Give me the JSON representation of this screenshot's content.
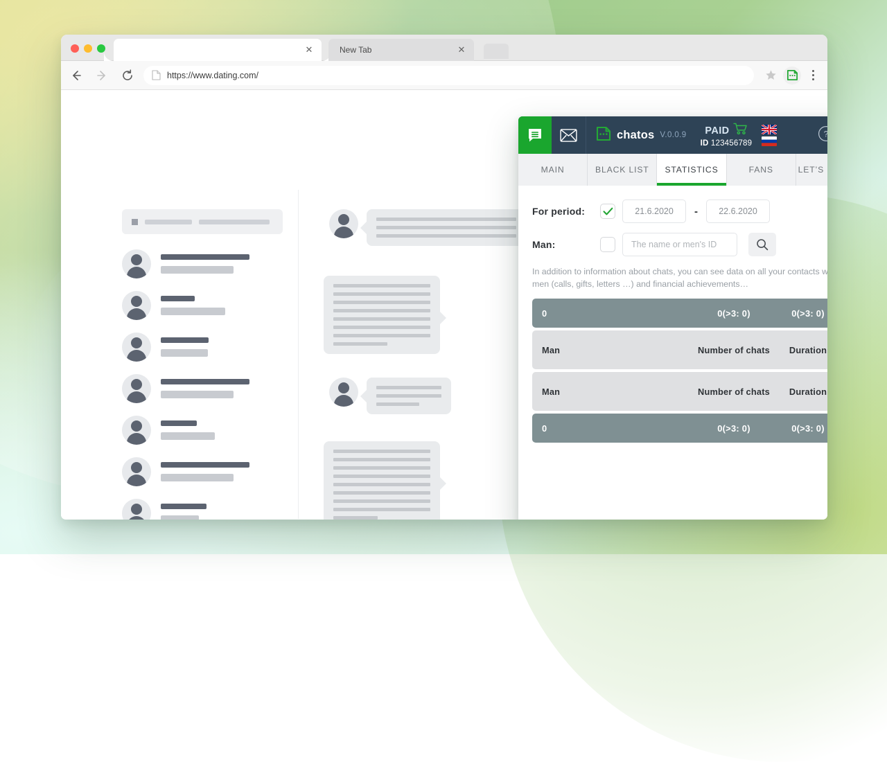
{
  "browser": {
    "tabs": [
      {
        "title": "",
        "active": true,
        "close_label": "✕"
      },
      {
        "title": "New Tab",
        "active": false,
        "close_label": "✕"
      }
    ],
    "url": "https://www.dating.com/",
    "back_icon": "back-arrow-icon",
    "forward_icon": "forward-arrow-icon",
    "reload_icon": "reload-icon",
    "page_icon": "page-document-icon",
    "bookmark_icon": "star-icon",
    "extension_icon": "chatos-extension-icon",
    "menu_icon": "three-dot-menu-icon",
    "traffic_lights": [
      "close",
      "minimize",
      "maximize"
    ]
  },
  "extension": {
    "header": {
      "chat_icon": "chat-bubble-icon",
      "mail_icon": "envelope-icon",
      "logo_icon": "chatos-logo-icon",
      "brand": "chatos",
      "version": "V.0.0.9",
      "status": "PAID",
      "cart_icon": "shopping-cart-icon",
      "id_prefix": "ID",
      "id_value": "123456789",
      "flags": [
        "flag-uk",
        "flag-russia"
      ],
      "help_icon": "help-circle-icon",
      "close_icon": "close-circle-icon",
      "bg_color": "#2e4356",
      "accent_color": "#1aa62e"
    },
    "tabs": [
      {
        "label": "MAIN",
        "active": false
      },
      {
        "label": "BLACK LIST",
        "active": false
      },
      {
        "label": "STATISTICS",
        "active": true
      },
      {
        "label": "FANS",
        "active": false
      },
      {
        "label": "LET’S MINGLE",
        "active": false
      }
    ],
    "form": {
      "period_label": "For period:",
      "period_checked": true,
      "date_from": "21.6.2020",
      "date_to": "22.6.2020",
      "date_separator": "-",
      "man_label": "Man:",
      "man_checked": false,
      "man_placeholder": "The name or men's ID",
      "man_value": "",
      "search_icon": "search-icon",
      "check_icon": "checkmark-icon"
    },
    "description": "In addition to information about chats, you can see data on all your contacts with men (calls, gifts, letters …) and financial achievements…",
    "table": {
      "columns": [
        "Man",
        "Number of chats",
        "Duration"
      ],
      "rows": [
        {
          "style": "summary",
          "man": "0",
          "chats": "0(>3: 0)",
          "duration": "0(>3: 0)"
        },
        {
          "style": "header",
          "man": "Man",
          "chats": "Number of chats",
          "duration": "Duration"
        },
        {
          "style": "header",
          "man": "Man",
          "chats": "Number of chats",
          "duration": "Duration"
        },
        {
          "style": "summary",
          "man": "0",
          "chats": "0(>3: 0)",
          "duration": "0(>3: 0)"
        }
      ]
    }
  },
  "page_skeleton": {
    "search_placeholder_blocks": 2,
    "contact_rows": 7,
    "message_bubbles": 3
  }
}
